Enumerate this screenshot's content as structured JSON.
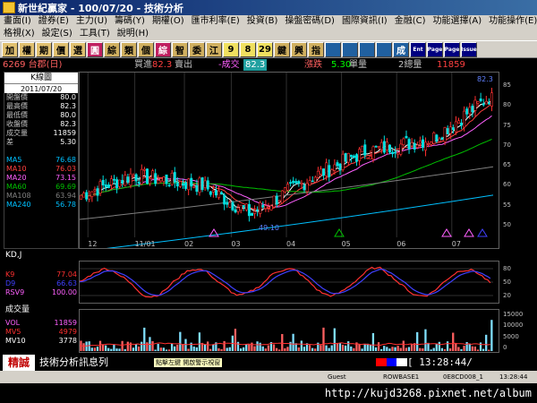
{
  "window": {
    "title": "新世紀贏家 - 100/07/20 - 技術分析"
  },
  "menu": {
    "row1": [
      "畫面(I)",
      "證券(E)",
      "主力(U)",
      "籌碼(Y)",
      "期權(O)",
      "匯市利率(E)",
      "投資(B)",
      "操盤密碼(D)",
      "國際資訊(I)",
      "金融(C)",
      "功能選擇(A)",
      "功能操作(E)"
    ],
    "row2": [
      "格視(X)",
      "設定(S)",
      "工具(T)",
      "說明(H)"
    ]
  },
  "toolbar": {
    "buttons": [
      "加",
      "權",
      "期",
      "價",
      "選",
      "圓",
      "綜",
      "類",
      "個",
      "綜",
      "智",
      "委",
      "江",
      "9",
      "8",
      "29",
      "鍵",
      "興",
      "指",
      "",
      "",
      "",
      "",
      "成",
      "Ent",
      "Page",
      "Page",
      "Issue"
    ]
  },
  "quote": {
    "code": "6269 台郡(日)",
    "bid_label": "買進",
    "bid": "82.3",
    "ask_label": "賣出",
    "change_label": "-成交",
    "last": "82.3",
    "vol_label": "漲跌",
    "change": "5.30",
    "unit": "單量",
    "total_label": "2總量",
    "total": "11859"
  },
  "panel": {
    "title": "K線圖",
    "date": "2011/07/20",
    "rows": [
      {
        "label": "開盤價",
        "value": "80.0"
      },
      {
        "label": "最高價",
        "value": "82.3"
      },
      {
        "label": "最低價",
        "value": "80.0"
      },
      {
        "label": "收盤價",
        "value": "82.3"
      },
      {
        "label": "成交量",
        "value": "11859"
      },
      {
        "label": "差",
        "value": "5.30"
      }
    ],
    "ma_rows": [
      {
        "label": "MA5",
        "value": "76.68"
      },
      {
        "label": "MA10",
        "value": "76.03"
      },
      {
        "label": "MA20",
        "value": "73.15"
      },
      {
        "label": "MA60",
        "value": "69.69"
      },
      {
        "label": "MA108",
        "value": "63.94"
      },
      {
        "label": "MA240",
        "value": "56.78"
      }
    ]
  },
  "colors": {
    "ma5": "#ffffff",
    "ma10": "#ff4040",
    "ma20": "#ff60ff",
    "ma60": "#00c000",
    "ma108": "#808080",
    "ma240": "#00c0ff",
    "up_candle": "#ff3030",
    "down_candle": "#00e0e0",
    "k_line": "#ff3030",
    "d_line": "#4040ff"
  },
  "main_chart": {
    "y_ticks": [
      "85",
      "80",
      "75",
      "70",
      "65",
      "60",
      "55",
      "50"
    ],
    "x_ticks": [
      "12",
      "11/01",
      "02",
      "03",
      "04",
      "05",
      "06",
      "07"
    ],
    "high_label": "82.3",
    "low_label": "49.10"
  },
  "kd": {
    "title": "KD,J",
    "rows": [
      {
        "label": "K9",
        "value": "77.04"
      },
      {
        "label": "D9",
        "value": "66.63"
      },
      {
        "label": "RSV9",
        "value": "100.00"
      }
    ],
    "y_ticks": [
      "80",
      "50",
      "20"
    ]
  },
  "volume": {
    "title": "成交量",
    "rows": [
      {
        "label": "VOL",
        "value": "11859"
      },
      {
        "label": "MV5",
        "value": "4979"
      },
      {
        "label": "MV10",
        "value": "3778"
      }
    ],
    "y_ticks": [
      "15000",
      "10000",
      "5000",
      "0"
    ]
  },
  "status": {
    "label": "精誠",
    "text": "技術分析訊息列",
    "hint": "點擊左鍵 開啟警示視窗",
    "time": "[    13:28:44/"
  },
  "bottom": {
    "items": [
      "Guest",
      "ROWBASE1",
      "0E8CD008_1",
      "13:28:44"
    ]
  },
  "url": "http://kujd3268.pixnet.net/album"
}
